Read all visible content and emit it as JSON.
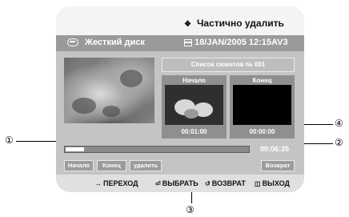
{
  "title": {
    "icon": "diamond-icon",
    "text": "Частично удалить"
  },
  "info": {
    "disk_icon": "hdd-icon",
    "disk_label": "Жесткий диск",
    "date_icon": "calendar-icon",
    "datetime": "18/JAN/2005 12:15AV3"
  },
  "list_header": "Список сюжетов № 001",
  "marks": {
    "start": {
      "label": "Начало",
      "time": "00:01:00"
    },
    "end": {
      "label": "Конец",
      "time": "00:00:00"
    }
  },
  "progress": {
    "fraction": 0.1
  },
  "total_time": "00:06:35",
  "buttons": {
    "start": "Начало",
    "end": "Конец",
    "delete": "удалить",
    "back": "Возврат"
  },
  "footer": {
    "move": {
      "icon": "left-right-arrows-icon",
      "label": "ПЕРЕХОД"
    },
    "select": {
      "icon": "enter-icon",
      "label": "ВЫБРАТЬ"
    },
    "return": {
      "icon": "return-icon",
      "label": "ВОЗВРАТ"
    },
    "exit": {
      "icon": "exit-icon",
      "label": "ВЫХОД"
    }
  },
  "callouts": {
    "c1": "①",
    "c2": "②",
    "c3": "③",
    "c4": "④"
  }
}
